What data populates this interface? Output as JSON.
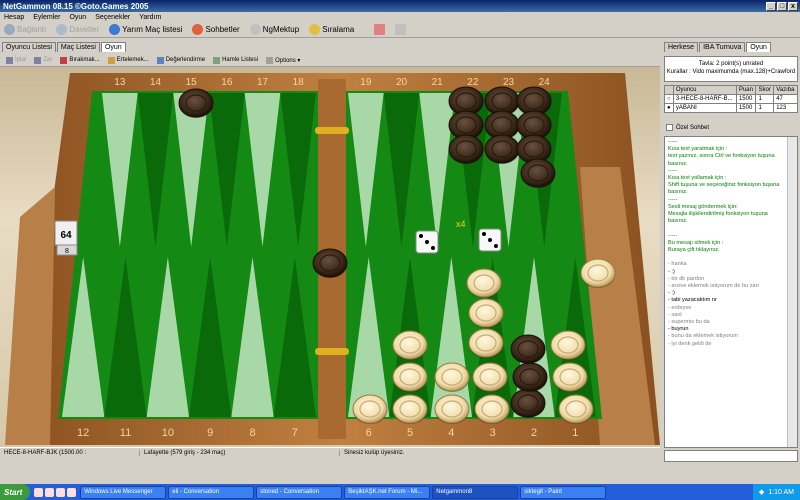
{
  "window": {
    "title": "NetGammon 08.15 ©Goto.Games 2005",
    "min": "_",
    "max": "□",
    "close": "x"
  },
  "menu": [
    "Hesap",
    "Eylemler",
    "Oyun",
    "Seçenekler",
    "Yardım"
  ],
  "toolbar": [
    {
      "label": "Bağlantı",
      "enabled": false,
      "icon": "connect-icon",
      "color": "#9ab"
    },
    {
      "label": "Davetler",
      "enabled": false,
      "icon": "invite-icon",
      "color": "#abc"
    },
    {
      "label": "Yarım Maç listesi",
      "enabled": true,
      "icon": "half-match-icon",
      "color": "#3a7ad0"
    },
    {
      "label": "Sohbetler",
      "enabled": true,
      "icon": "chat-icon",
      "color": "#e06040"
    },
    {
      "label": "NgMektup",
      "enabled": true,
      "icon": "mail-icon",
      "color": "#c0c0c0"
    },
    {
      "label": "Sıralama",
      "enabled": true,
      "icon": "ranking-icon",
      "color": "#e0c040"
    }
  ],
  "left_tabs": [
    {
      "label": "Oyuncu Listesi",
      "active": false
    },
    {
      "label": "Maç Listesi",
      "active": false
    },
    {
      "label": "Oyun",
      "active": true
    }
  ],
  "right_tabs": [
    {
      "label": "Herkese",
      "active": false
    },
    {
      "label": "IBA Turnuva",
      "active": false
    },
    {
      "label": "Oyun",
      "active": true
    }
  ],
  "game_toolbar": [
    {
      "label": "İptal",
      "enabled": false
    },
    {
      "label": "Zar",
      "enabled": false
    },
    {
      "label": "Bırakmak...",
      "enabled": true
    },
    {
      "label": "Ertelemek...",
      "enabled": true
    },
    {
      "label": "Değerlendirme",
      "enabled": true
    },
    {
      "label": "Hamle Listesi",
      "enabled": true
    },
    {
      "label": "Options ▾",
      "enabled": true
    }
  ],
  "board": {
    "top_points": [
      "13",
      "14",
      "15",
      "16",
      "17",
      "18",
      "19",
      "20",
      "21",
      "22",
      "23",
      "24"
    ],
    "bottom_points": [
      "12",
      "11",
      "10",
      "9",
      "8",
      "7",
      "6",
      "5",
      "4",
      "3",
      "2",
      "1"
    ],
    "doubling_cube": "64",
    "doubling_cube_side": "8",
    "dice": [
      3,
      3
    ],
    "dice_multiplier": "x4",
    "colors": {
      "green": "#148a14",
      "light_point": "#a8d8a8",
      "dark_point": "#0a6a0a",
      "wood": "#a06830",
      "dark_checker": "#4a3220",
      "light_checker": "#f0e0b0"
    }
  },
  "game_info": {
    "line1": "Tavla: 2 point(s) unrated",
    "line2": "Kurallar : Vido maximumda (max.128)+Crawford"
  },
  "players": {
    "headers": [
      "",
      "Oyuncu",
      "Puan",
      "Skor",
      "Vazıba"
    ],
    "rows": [
      {
        "marker": "○",
        "name": "3-HECE-8-HARF-B...",
        "rating": "1500",
        "score": "1",
        "extra": "47"
      },
      {
        "marker": "●",
        "name": "yABANI",
        "rating": "1500",
        "score": "1",
        "extra": "123"
      }
    ]
  },
  "ozel_sohbet": "Özel Sohbet",
  "chat": [
    {
      "text": "-----",
      "style": "green"
    },
    {
      "text": "Kısa text yaratmak için :",
      "style": "green"
    },
    {
      "text": "text yazınız, sonra Ctrl ve fonksiyon tuşuna basınız.",
      "style": "green"
    },
    {
      "text": "-----",
      "style": "green"
    },
    {
      "text": "Kısa text yollamak için :",
      "style": "green"
    },
    {
      "text": "Shift tuşuna ve seçeceğiniz fonksiyon tuşuna basınız.",
      "style": "green"
    },
    {
      "text": "-----",
      "style": "green"
    },
    {
      "text": "Sesli mesaj göndermek için:",
      "style": "green"
    },
    {
      "text": "Mesajla ilişkilendirilmiş fonksiyon tuşuna basınız.",
      "style": "green"
    },
    {
      "text": "",
      "style": "green"
    },
    {
      "text": "-----",
      "style": "green"
    },
    {
      "text": "Bu mesajı silmek için :",
      "style": "green"
    },
    {
      "text": "Buraya çift tıklayınız.",
      "style": "green"
    },
    {
      "text": "",
      "style": "gray"
    },
    {
      "text": "- hanka",
      "style": "gray"
    },
    {
      "text": "- :)",
      "style": "black"
    },
    {
      "text": "- bir dk pardon",
      "style": "gray"
    },
    {
      "text": "- arsive eklemek istiyorum de bu zari",
      "style": "gray"
    },
    {
      "text": "- :)",
      "style": "black"
    },
    {
      "text": "- tabi yazacaktım  nr",
      "style": "black"
    },
    {
      "text": "- erdeyse",
      "style": "gray"
    },
    {
      "text": "- saol",
      "style": "gray"
    },
    {
      "text": "- supermis bu da",
      "style": "gray"
    },
    {
      "text": "- buyrun",
      "style": "black"
    },
    {
      "text": "- bunu da eklemek istiyorum",
      "style": "gray"
    },
    {
      "text": "- iyi denk geldi de",
      "style": "gray"
    }
  ],
  "status": {
    "player": "HECE-8-HARF-BJK (1500.00 :",
    "opponent": "Lafayette (579 giriş - 234 maç)",
    "kulup": "Sinesiz kulüp üyesiniz."
  },
  "taskbar": {
    "start": "Start",
    "items": [
      {
        "label": "Windows Live Messenger",
        "active": false
      },
      {
        "label": "eli - Conversation",
        "active": false
      },
      {
        "label": "stoned - Conversation",
        "active": false
      },
      {
        "label": "BeşiktAŞK.net Forum - Mi...",
        "active": false
      },
      {
        "label": "Netgammon8",
        "active": true
      },
      {
        "label": "siktegit - Paint",
        "active": false
      }
    ],
    "time": "1:10 AM"
  }
}
